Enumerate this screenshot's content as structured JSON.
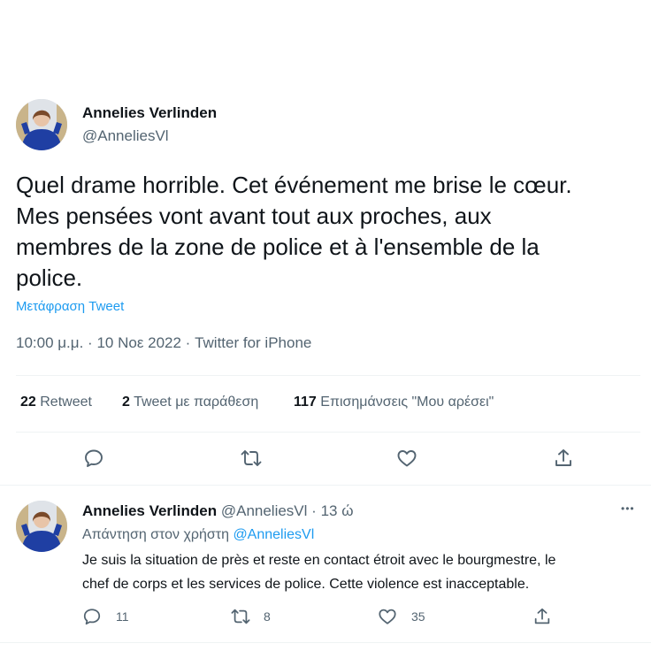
{
  "main_tweet": {
    "author_name": "Annelies Verlinden",
    "author_handle": "@AnneliesVl",
    "text_lines": [
      "Quel drame horrible. Cet événement me brise le cœur.",
      "Mes pensées vont avant tout aux proches, aux",
      "membres de la zone de police et à l'ensemble de la",
      "police."
    ],
    "translate_link": "Μετάφραση Tweet",
    "time": "10:00 μ.μ.",
    "sep1": "·",
    "date": "10 Νοε 2022",
    "sep2": "·",
    "source": "Twitter for iPhone",
    "stats": {
      "retweets_count": "22",
      "retweets_label": "Retweet",
      "quotes_count": "2",
      "quotes_label": "Tweet με παράθεση",
      "likes_count": "117",
      "likes_label": "Επισημάνσεις \"Μου αρέσει\""
    },
    "actions": [
      "reply-icon",
      "retweet-icon",
      "like-icon",
      "share-icon"
    ]
  },
  "reply_tweet": {
    "author_name": "Annelies Verlinden",
    "author_handle": "@AnneliesVl",
    "dot": "·",
    "time_ago": "13 ώ",
    "replying_prefix": "Απάντηση στον χρήστη",
    "replying_to": "@AnneliesVl",
    "text_lines": [
      "Je suis la situation de près et reste en contact étroit avec le bourgmestre, le",
      "chef de corps et les services de police. Cette violence est inacceptable."
    ],
    "more_label": "•••",
    "counts": {
      "replies": "11",
      "retweets": "8",
      "likes": "35"
    }
  },
  "colors": {
    "text": "#0f1419",
    "secondary": "#536471",
    "link": "#1d9bf0",
    "divider": "#eff3f4"
  }
}
